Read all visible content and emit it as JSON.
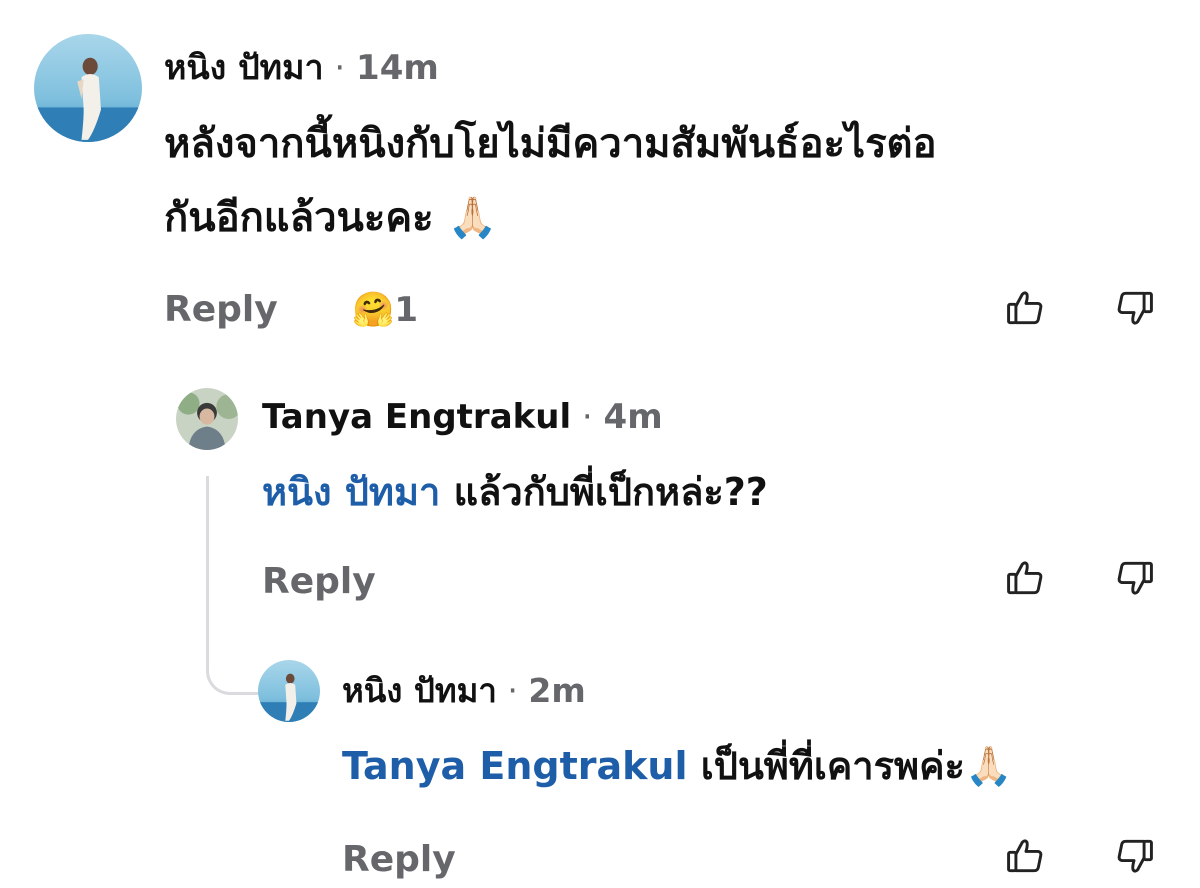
{
  "comments": [
    {
      "author": "หนิง ปัทมา",
      "time": "14m",
      "text_line1": "หลังจากนี้หนิงกับโยไม่มีความสัมพันธ์อะไรต่อ",
      "text_line2": "กันอีกแล้วนะคะ",
      "emoji": "🙏🏻",
      "reply_label": "Reply",
      "reaction_emoji": "🤗",
      "reaction_icon": "care-reaction-icon",
      "reaction_count": "1"
    },
    {
      "author": "Tanya Engtrakul",
      "time": "4m",
      "mention": "หนิง ปัทมา",
      "text": "แล้วกับพี่เป็กหล่ะ??",
      "reply_label": "Reply"
    },
    {
      "author": "หนิง ปัทมา",
      "time": "2m",
      "mention": "Tanya Engtrakul",
      "text": "เป็นพี่ที่เคารพค่ะ",
      "emoji": "🙏🏻",
      "reply_label": "Reply"
    }
  ],
  "separator": "·",
  "icons": {
    "like": "thumbs-up-icon",
    "dislike": "thumbs-down-icon"
  },
  "colors": {
    "mention": "#1e5ea8",
    "meta": "#65676b",
    "text": "#111111",
    "thread_line": "#d9dbdf"
  }
}
